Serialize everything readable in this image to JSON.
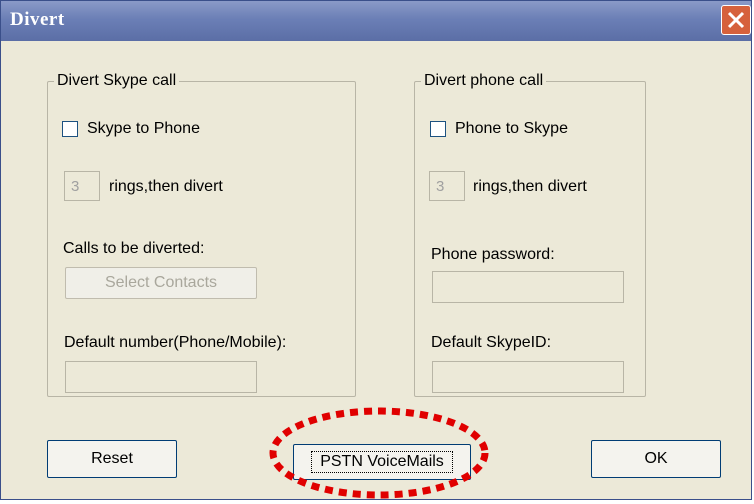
{
  "window": {
    "title": "Divert"
  },
  "skype_group": {
    "legend": "Divert Skype call",
    "checkbox_label": "Skype to Phone",
    "rings_value": "3",
    "rings_label": "rings,then divert",
    "calls_label": "Calls to be diverted:",
    "select_contacts_label": "Select Contacts",
    "default_number_label": "Default number(Phone/Mobile):",
    "default_number_value": ""
  },
  "phone_group": {
    "legend": "Divert phone call",
    "checkbox_label": "Phone to Skype",
    "rings_value": "3",
    "rings_label": "rings,then divert",
    "password_label": "Phone password:",
    "password_value": "",
    "skypeid_label": "Default SkypeID:",
    "skypeid_value": ""
  },
  "buttons": {
    "reset": "Reset",
    "voicemail": "PSTN VoiceMails",
    "ok": "OK"
  },
  "colors": {
    "highlight_ellipse": "#e00000"
  }
}
